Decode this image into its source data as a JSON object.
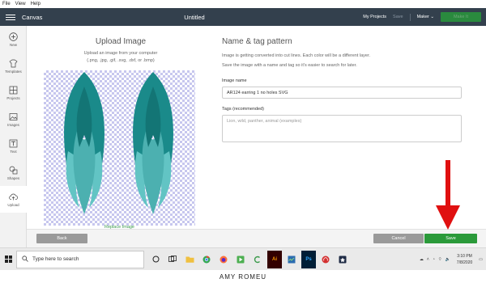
{
  "menu": [
    "File",
    "View",
    "Help"
  ],
  "topbar": {
    "app_name": "Canvas",
    "doc_title": "Untitled",
    "my_projects": "My Projects",
    "save": "Save",
    "machine": "Maker",
    "make_it": "Make It"
  },
  "sidebar": {
    "items": [
      {
        "label": "New",
        "icon": "plus-icon"
      },
      {
        "label": "Templates",
        "icon": "shirt-icon"
      },
      {
        "label": "Projects",
        "icon": "grid-icon"
      },
      {
        "label": "Images",
        "icon": "image-icon"
      },
      {
        "label": "Text",
        "icon": "text-icon"
      },
      {
        "label": "Shapes",
        "icon": "shapes-icon"
      },
      {
        "label": "Upload",
        "icon": "cloud-upload-icon"
      }
    ]
  },
  "upload": {
    "title": "Upload Image",
    "subtitle": "Upload an image from your computer",
    "formats": "(.png, .jpg, .gif, .svg, .dxf, or .bmp)",
    "replace": "Replace Image"
  },
  "form": {
    "title": "Name & tag pattern",
    "desc1": "Image is getting converted into cut lines. Each color will be a different layer.",
    "desc2": "Save the image with a name and tag so it's easier to search for later.",
    "name_label": "Image name",
    "name_value": "AR124 earring 1 no holes SVG",
    "tags_label": "Tags (recommended)",
    "tags_placeholder": "Lion, wild, panther, animal (examples)"
  },
  "buttons": {
    "back": "Back",
    "cancel": "Cancel",
    "save": "Save"
  },
  "taskbar": {
    "search_placeholder": "Type here to search",
    "time": "3:10 PM",
    "date": "7/8/2020"
  },
  "caption": "AMY ROMEU",
  "colors": {
    "topbar": "#33404d",
    "accent_green": "#2b9a3a",
    "arrow_red": "#e01010",
    "leaf_dark": "#1a8a8a",
    "leaf_light": "#62c4c4"
  }
}
